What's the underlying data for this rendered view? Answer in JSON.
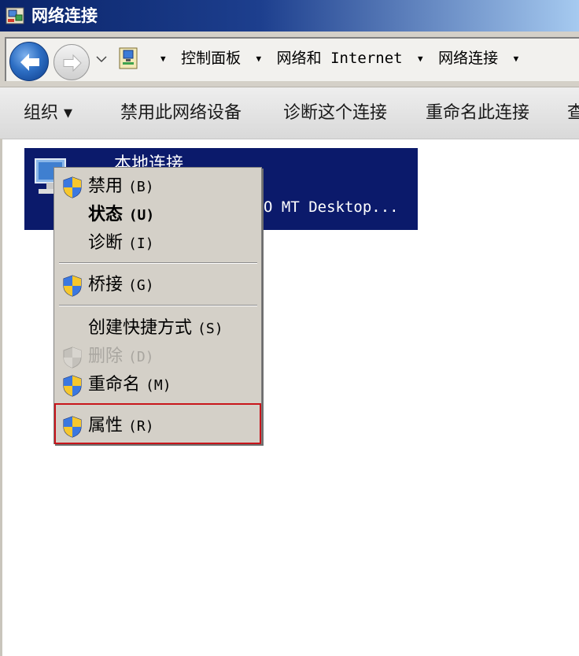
{
  "window": {
    "title": "网络连接"
  },
  "address": {
    "crumbs": [
      "控制面板",
      "网络和 Internet",
      "网络连接"
    ]
  },
  "toolbar": {
    "organize": "组织 ▾",
    "disable": "禁用此网络设备",
    "diagnose": "诊断这个连接",
    "rename": "重命名此连接",
    "view_cut": "查"
  },
  "connection": {
    "name": "本地连接",
    "device": "O MT Desktop..."
  },
  "context_menu": {
    "items": [
      {
        "label": "禁用",
        "accel": "(B)",
        "icon": "uac-shield-icon"
      },
      {
        "label": "状态",
        "accel": "(U)",
        "bold": true
      },
      {
        "label": "诊断",
        "accel": "(I)"
      },
      {
        "label": "桥接",
        "accel": "(G)",
        "icon": "uac-shield-icon"
      },
      {
        "label": "创建快捷方式",
        "accel": "(S)"
      },
      {
        "label": "删除",
        "accel": "(D)",
        "icon": "uac-shield-icon",
        "disabled": true
      },
      {
        "label": "重命名",
        "accel": "(M)",
        "icon": "uac-shield-icon"
      },
      {
        "label": "属性",
        "accel": "(R)",
        "icon": "uac-shield-icon",
        "highlighted": true
      }
    ]
  },
  "colors": {
    "selection": "#0b1a6b",
    "menu_bg": "#d4d0c8",
    "highlight_border": "#c8151b"
  }
}
